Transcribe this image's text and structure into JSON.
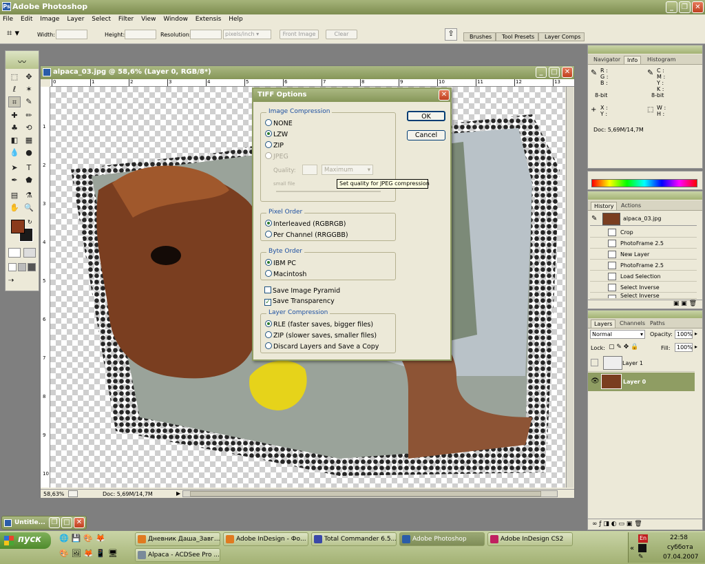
{
  "app": {
    "title": "Adobe Photoshop"
  },
  "menu": [
    "File",
    "Edit",
    "Image",
    "Layer",
    "Select",
    "Filter",
    "View",
    "Window",
    "Extensis",
    "Help"
  ],
  "options": {
    "width_label": "Width:",
    "height_label": "Height:",
    "resolution_label": "Resolution:",
    "units": "pixels/inch",
    "front_image": "Front Image",
    "clear": "Clear"
  },
  "well_tabs": [
    "Brushes",
    "Tool Presets",
    "Layer Comps"
  ],
  "document": {
    "title": "alpaca_03.jpg @ 58,6% (Layer 0, RGB/8*)",
    "zoom": "58,63%",
    "doc_size": "Doc: 5,69M/14,7M",
    "ruler_top": [
      "0",
      "1",
      "2",
      "3",
      "4",
      "5",
      "6",
      "7",
      "8",
      "9",
      "10",
      "11",
      "12",
      "13"
    ],
    "ruler_left": [
      "1",
      "2",
      "3",
      "4",
      "5",
      "6",
      "7",
      "8",
      "9",
      "10"
    ]
  },
  "dialog": {
    "title": "TIFF Options",
    "ok": "OK",
    "cancel": "Cancel",
    "image_compression": {
      "title": "Image Compression",
      "options": [
        "NONE",
        "LZW",
        "ZIP",
        "JPEG"
      ],
      "selected": "LZW",
      "quality_label": "Quality:",
      "quality_preset": "Maximum",
      "small_file": "small file"
    },
    "tooltip": "Set quality for JPEG compression",
    "pixel_order": {
      "title": "Pixel Order",
      "options": [
        "Interleaved (RGBRGB)",
        "Per Channel (RRGGBB)"
      ],
      "selected": "Interleaved (RGBRGB)"
    },
    "byte_order": {
      "title": "Byte Order",
      "options": [
        "IBM PC",
        "Macintosh"
      ],
      "selected": "IBM PC"
    },
    "save_image_pyramid": {
      "label": "Save Image Pyramid",
      "checked": false
    },
    "save_transparency": {
      "label": "Save Transparency",
      "checked": true
    },
    "layer_compression": {
      "title": "Layer Compression",
      "options": [
        "RLE (faster saves, bigger files)",
        "ZIP (slower saves, smaller files)",
        "Discard Layers and Save a Copy"
      ],
      "selected": "RLE (faster saves, bigger files)"
    }
  },
  "info_panel": {
    "tabs": [
      "Navigator",
      "Info",
      "Histogram"
    ],
    "active_tab": "Info",
    "rgb": [
      "R :",
      "G :",
      "B :"
    ],
    "cmyk": [
      "C :",
      "M :",
      "Y :",
      "K :"
    ],
    "bits_left": "8-bit",
    "bits_right": "8-bit",
    "xy": [
      "X :",
      "Y :"
    ],
    "wh": [
      "W :",
      "H :"
    ],
    "doc": "Doc: 5,69M/14,7M"
  },
  "history_panel": {
    "tabs": [
      "History",
      "Actions"
    ],
    "active_tab": "History",
    "snapshot": "alpaca_03.jpg",
    "items": [
      "Crop",
      "PhotoFrame 2.5",
      "New Layer",
      "PhotoFrame 2.5",
      "Load Selection",
      "Select Inverse",
      "Select Inverse"
    ]
  },
  "layers_panel": {
    "tabs": [
      "Layers",
      "Channels",
      "Paths"
    ],
    "active_tab": "Layers",
    "blend_mode": "Normal",
    "opacity_label": "Opacity:",
    "opacity": "100%",
    "lock_label": "Lock:",
    "fill_label": "Fill:",
    "fill": "100%",
    "layers": [
      {
        "name": "Layer 1",
        "visible": false
      },
      {
        "name": "Layer 0",
        "visible": true,
        "selected": true
      }
    ]
  },
  "minimized_window": {
    "title": "Untitle..."
  },
  "taskbar": {
    "start": "пуск",
    "row1": [
      "Дневник Даша_Завг...",
      "Adobe InDesign - Фо...",
      "Total Commander 6.5...",
      "Adobe Photoshop",
      "Adobe InDesign CS2"
    ],
    "active": "Adobe Photoshop",
    "row2": [
      "Alpaca - ACDSee Pro ..."
    ],
    "lang": "En",
    "time": "22:58",
    "day": "суббота",
    "date": "07.04.2007"
  },
  "colors": {
    "accent": "#8f9d63",
    "foreground_swatch": "#8a3a1c",
    "background_swatch": "#1a1a1a",
    "selection": "#8f9d63"
  }
}
